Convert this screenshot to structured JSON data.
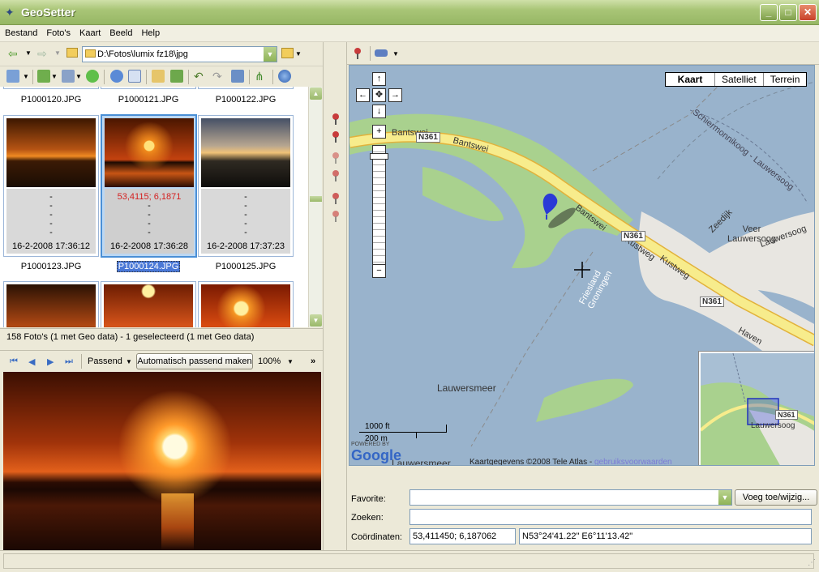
{
  "window": {
    "title": "GeoSetter"
  },
  "menu": [
    "Bestand",
    "Foto's",
    "Kaart",
    "Beeld",
    "Help"
  ],
  "address": {
    "path": "D:\\Fotos\\lumix fz18\\jpg"
  },
  "thumbnails": {
    "top_row_names": [
      "P1000120.JPG",
      "P1000121.JPG",
      "P1000122.JPG"
    ],
    "cards": [
      {
        "coord": "",
        "lines": [
          "-",
          "-",
          "-",
          "-",
          "-"
        ],
        "date": "16-2-2008 17:36:12",
        "name": "P1000123.JPG"
      },
      {
        "coord": "53,4115; 6,1871",
        "lines": [
          "-",
          "-",
          "-",
          "-"
        ],
        "date": "16-2-2008 17:36:28",
        "name": "P1000124.JPG"
      },
      {
        "coord": "",
        "lines": [
          "-",
          "-",
          "-",
          "-",
          "-"
        ],
        "date": "16-2-2008 17:37:23",
        "name": "P1000125.JPG"
      }
    ]
  },
  "status": {
    "summary": "158 Foto's (1 met Geo data) - 1 geselecteerd (1 met Geo data)"
  },
  "viewer": {
    "fit_mode": "Passend",
    "auto_fit_label": "Automatisch passend maken",
    "zoom": "100%"
  },
  "map": {
    "types": [
      "Kaart",
      "Satelliet",
      "Terrein"
    ],
    "labels": {
      "lake": "Lauwersmeer",
      "lake2": "Lauwersmeer",
      "ferry": "Veer\nLauwersoog",
      "lauwersoog": "Lauwersoog",
      "schier": "Schiermonnikoog - Lauwersoog",
      "friesland": "Friesland\nGroningen",
      "zeedijk": "Zeedijk",
      "haven": "Haven",
      "bantsweil": "Bantswei",
      "bantswei1": "Bantswei",
      "bantswei2": "Bantswei",
      "kustweg1": "Kustweg",
      "kustweg2": "Kustweg",
      "n361a": "N361",
      "n361b": "N361",
      "n361c": "N361",
      "mini_n361": "N361",
      "mini_lauwersoog": "Lauwersoog"
    },
    "scale_ft": "1000 ft",
    "scale_m": "200 m",
    "powered": "POWERED BY",
    "google": "Google",
    "attribution": "Kaartgegevens ©2008 Tele Atlas - ",
    "attribution_link": "gebruiksvoorwaarden"
  },
  "form": {
    "favorite_label": "Favorite:",
    "favorite_value": "",
    "add_button": "Voeg toe/wijzig...",
    "search_label": "Zoeken:",
    "search_value": "",
    "coords_label": "Coördinaten:",
    "coords_decimal": "53,411450; 6,187062",
    "coords_dms": "N53°24'41.22\" E6°11'13.42\""
  },
  "colors": {
    "titlebar": "#a9c577",
    "selection": "#4a8fd6",
    "water": "#99b3cc",
    "road": "#f7ec8c",
    "land": "#a9d18e"
  }
}
